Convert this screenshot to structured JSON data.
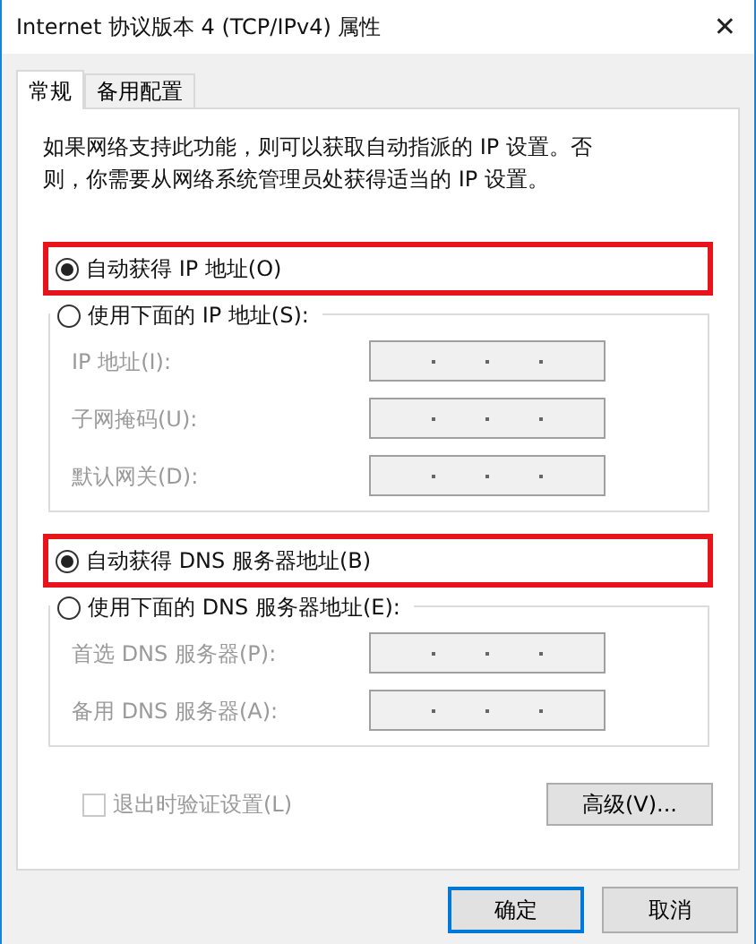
{
  "window": {
    "title": "Internet 协议版本 4 (TCP/IPv4) 属性",
    "close": "✕"
  },
  "tabs": [
    {
      "label": "常规",
      "selected": true
    },
    {
      "label": "备用配置",
      "selected": false
    }
  ],
  "description": "如果网络支持此功能，则可以获取自动指派的 IP 设置。否则，你需要从网络系统管理员处获得适当的 IP 设置。",
  "sections": [
    {
      "auto": {
        "label": "自动获得 IP 地址(O)",
        "selected": true,
        "highlighted": true
      },
      "manual": {
        "label": "使用下面的 IP 地址(S):",
        "selected": false
      },
      "fields": [
        {
          "label": "IP 地址(I):",
          "disabled": true
        },
        {
          "label": "子网掩码(U):",
          "disabled": true
        },
        {
          "label": "默认网关(D):",
          "disabled": true
        }
      ]
    },
    {
      "auto": {
        "label": "自动获得 DNS 服务器地址(B)",
        "selected": true,
        "highlighted": true
      },
      "manual": {
        "label": "使用下面的 DNS 服务器地址(E):",
        "selected": false
      },
      "fields": [
        {
          "label": "首选 DNS 服务器(P):",
          "disabled": true
        },
        {
          "label": "备用 DNS 服务器(A):",
          "disabled": true
        }
      ]
    }
  ],
  "validate": {
    "label": "退出时验证设置(L)",
    "checked": false,
    "disabled": true
  },
  "advanced_button": "高级(V)...",
  "buttons": [
    {
      "label": "确定",
      "default": true
    },
    {
      "label": "取消",
      "default": false
    }
  ]
}
